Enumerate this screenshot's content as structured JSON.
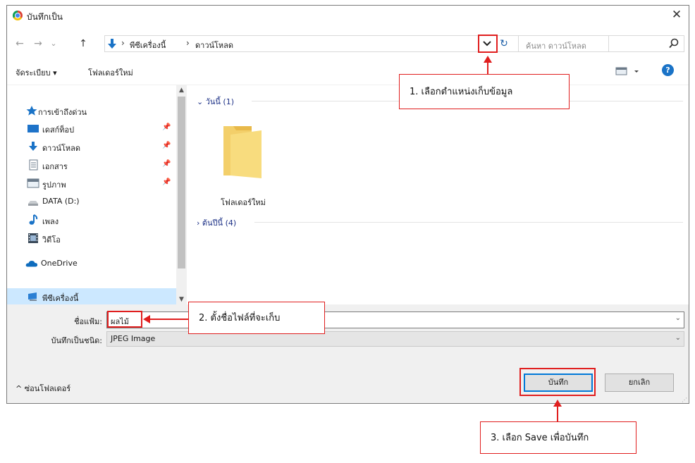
{
  "window": {
    "title": "บันทึกเป็น",
    "close": "✕"
  },
  "nav": {
    "back": "←",
    "forward": "→",
    "history": "⌄",
    "up": "↑",
    "breadcrumbs": [
      "พีซีเครื่องนี้",
      "ดาวน์โหลด"
    ],
    "crumb_sep": "›",
    "dropdown": "⌄",
    "refresh": "↻",
    "search_placeholder": "ค้นหา ดาวน์โหลด"
  },
  "toolbar": {
    "organize": "จัดระเบียบ ▾",
    "new_folder": "โฟลเดอร์ใหม่",
    "help": "?"
  },
  "sidebar": {
    "items": [
      {
        "label": "การเข้าถึงด่วน",
        "icon": "star-icon"
      },
      {
        "label": "เดสก์ท็อป",
        "icon": "desktop-icon",
        "pinned": true
      },
      {
        "label": "ดาวน์โหลด",
        "icon": "download-icon",
        "pinned": true
      },
      {
        "label": "เอกสาร",
        "icon": "document-icon",
        "pinned": true
      },
      {
        "label": "รูปภาพ",
        "icon": "pictures-icon",
        "pinned": true
      },
      {
        "label": "DATA (D:)",
        "icon": "drive-icon"
      },
      {
        "label": "เพลง",
        "icon": "music-icon"
      },
      {
        "label": "วิดีโอ",
        "icon": "video-icon"
      },
      {
        "label": "OneDrive",
        "icon": "cloud-icon"
      },
      {
        "label": "พีซีเครื่องนี้",
        "icon": "computer-icon",
        "selected": true
      }
    ]
  },
  "content": {
    "groups": [
      {
        "header": "วันนี้ (1)",
        "expanded": true
      },
      {
        "header": "ต้นปีนี้ (4)",
        "expanded": false
      }
    ],
    "items": [
      {
        "name": "โฟลเดอร์ใหม่",
        "icon": "folder-icon"
      }
    ]
  },
  "form": {
    "filename_label": "ชื่อแฟ้ม:",
    "filename_value": "ผลไม้",
    "filetype_label": "บันทึกเป็นชนิด:",
    "filetype_value": "JPEG Image",
    "hide_folders": "ซ่อนโฟลเดอร์",
    "save": "บันทึก",
    "cancel": "ยกเลิก"
  },
  "annotations": {
    "note1": "1. เลือกตำแหน่งเก็บข้อมูล",
    "note2": "2. ตั้งชื่อไฟล์ที่จะเก็บ",
    "note3": "3. เลือก Save เพื่อบันทึก",
    "color": "#e01e1e"
  }
}
